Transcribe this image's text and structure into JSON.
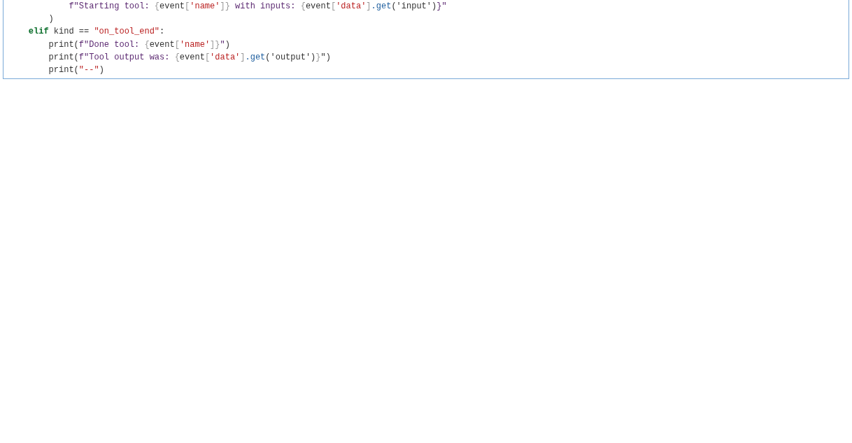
{
  "code_cell": {
    "lines": [
      [
        {
          "text": "            f\"Starting tool: ",
          "kind": "fstr"
        },
        {
          "text": "{",
          "kind": "brace"
        },
        {
          "text": "event",
          "kind": "name"
        },
        {
          "text": "[",
          "kind": "brace"
        },
        {
          "text": "'name'",
          "kind": "str"
        },
        {
          "text": "]}",
          "kind": "brace"
        },
        {
          "text": " with inputs: ",
          "kind": "fstr"
        },
        {
          "text": "{",
          "kind": "brace"
        },
        {
          "text": "event",
          "kind": "name"
        },
        {
          "text": "[",
          "kind": "brace"
        },
        {
          "text": "'data'",
          "kind": "str"
        },
        {
          "text": "]",
          "kind": "brace"
        },
        {
          "text": ".get",
          "kind": "fn"
        },
        {
          "text": "('input')",
          "kind": "name"
        },
        {
          "text": "}\"",
          "kind": "fstr"
        }
      ],
      [
        {
          "text": "        )",
          "kind": "name"
        }
      ],
      [
        {
          "text": "    elif",
          "kind": "kw"
        },
        {
          "text": " kind == ",
          "kind": "name"
        },
        {
          "text": "\"on_tool_end\"",
          "kind": "str"
        },
        {
          "text": ":",
          "kind": "name"
        }
      ],
      [
        {
          "text": "        print(",
          "kind": "name"
        },
        {
          "text": "f\"Done tool: ",
          "kind": "fstr"
        },
        {
          "text": "{",
          "kind": "brace"
        },
        {
          "text": "event",
          "kind": "name"
        },
        {
          "text": "[",
          "kind": "brace"
        },
        {
          "text": "'name'",
          "kind": "str"
        },
        {
          "text": "]}",
          "kind": "brace"
        },
        {
          "text": "\"",
          "kind": "fstr"
        },
        {
          "text": ")",
          "kind": "name"
        }
      ],
      [
        {
          "text": "        print(",
          "kind": "name"
        },
        {
          "text": "f\"Tool output was: ",
          "kind": "fstr"
        },
        {
          "text": "{",
          "kind": "brace"
        },
        {
          "text": "event",
          "kind": "name"
        },
        {
          "text": "[",
          "kind": "brace"
        },
        {
          "text": "'data'",
          "kind": "str"
        },
        {
          "text": "]",
          "kind": "brace"
        },
        {
          "text": ".get",
          "kind": "fn"
        },
        {
          "text": "('output')",
          "kind": "name"
        },
        {
          "text": "}",
          "kind": "brace"
        },
        {
          "text": "\")",
          "kind": "name"
        }
      ],
      [
        {
          "text": "        print(",
          "kind": "name"
        },
        {
          "text": "\"--\"",
          "kind": "str"
        },
        {
          "text": ")",
          "kind": "name"
        }
      ]
    ]
  }
}
